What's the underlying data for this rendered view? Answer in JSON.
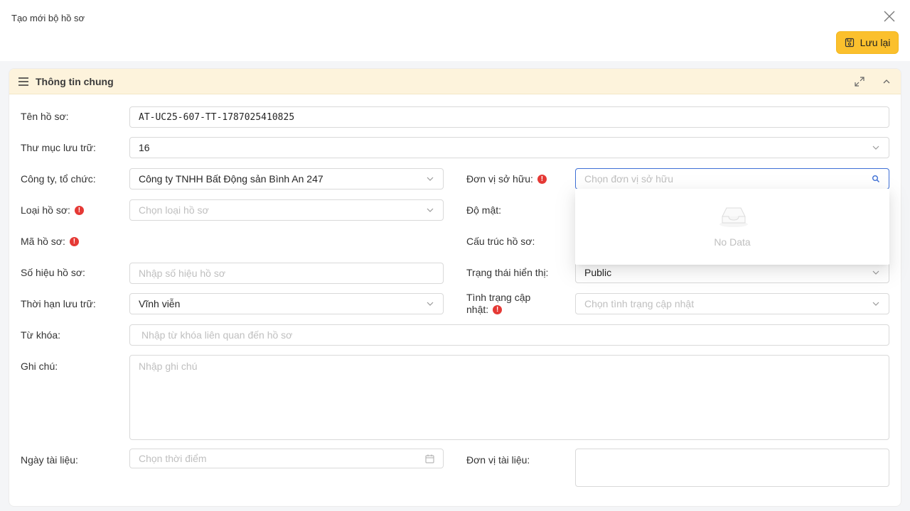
{
  "modal": {
    "title": "Tạo mới bộ hồ sơ",
    "save_label": "Lưu lại"
  },
  "section": {
    "title": "Thông tin chung"
  },
  "fields": {
    "ten_ho_so": {
      "label": "Tên hồ sơ:",
      "value": "AT-UC25-607-TT-1787025410825"
    },
    "thu_muc": {
      "label": "Thư mục lưu trữ:",
      "value": "16"
    },
    "cong_ty": {
      "label": "Công ty, tổ chức:",
      "value": "Công ty TNHH Bất Động sản Bình An 247"
    },
    "don_vi_so_huu": {
      "label": "Đơn vị sở hữu:",
      "placeholder": "Chọn đơn vị sở hữu"
    },
    "loai_ho_so": {
      "label": "Loại hồ sơ:",
      "placeholder": "Chọn loại hồ sơ"
    },
    "do_mat": {
      "label": "Độ mật:"
    },
    "ma_ho_so": {
      "label": "Mã hồ sơ:"
    },
    "cau_truc": {
      "label": "Cấu trúc hồ sơ:"
    },
    "so_hieu": {
      "label": "Số hiệu hồ sơ:",
      "placeholder": "Nhập số hiệu hồ sơ"
    },
    "trang_thai": {
      "label": "Trạng thái hiển thị:",
      "value": "Public"
    },
    "thoi_han": {
      "label": "Thời hạn lưu trữ:",
      "value": "Vĩnh viễn"
    },
    "tinh_trang": {
      "label_line1": "Tình trạng cập",
      "label_line2": "nhật:",
      "placeholder": "Chọn tình trạng cập nhật"
    },
    "tu_khoa": {
      "label": "Từ khóa:",
      "placeholder": "Nhập từ khóa liên quan đến hồ sơ"
    },
    "ghi_chu": {
      "label": "Ghi chú:",
      "placeholder": "Nhập ghi chú"
    },
    "ngay_tai_lieu": {
      "label": "Ngày tài liệu:",
      "placeholder": "Chọn thời điểm"
    },
    "don_vi_tai_lieu": {
      "label": "Đơn vị tài liệu:"
    }
  },
  "dropdown": {
    "empty_text": "No Data"
  },
  "colors": {
    "accent": "#fbc02d",
    "header_bg": "#fdf3dc",
    "required": "#e53935",
    "focus_border": "#3d6fd6"
  }
}
